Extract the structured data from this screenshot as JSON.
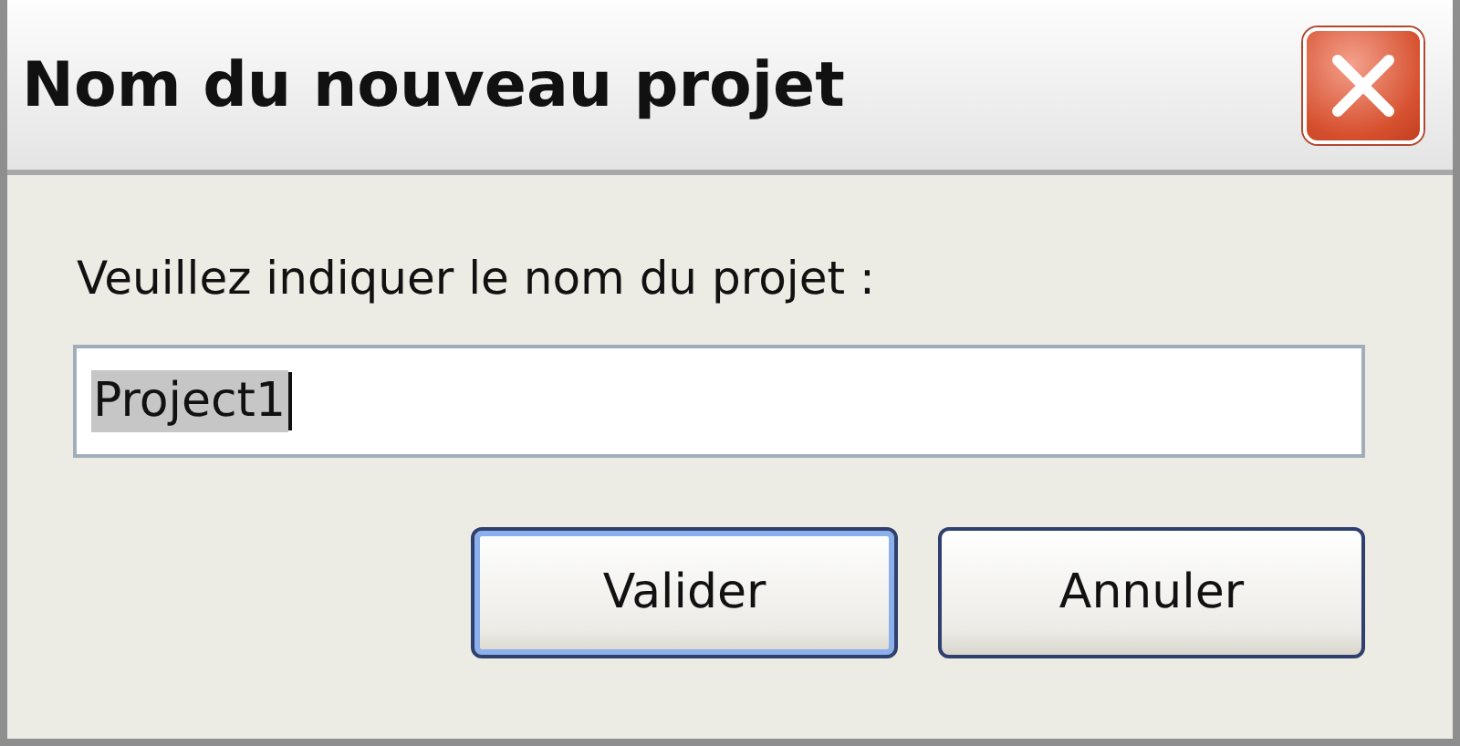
{
  "window": {
    "title": "Nom du nouveau projet"
  },
  "prompt": "Veuillez indiquer le nom du projet :",
  "field": {
    "value": "Project1",
    "selected": true
  },
  "buttons": [
    {
      "label": "Valider",
      "default": true
    },
    {
      "label": "Annuler",
      "default": false
    }
  ]
}
